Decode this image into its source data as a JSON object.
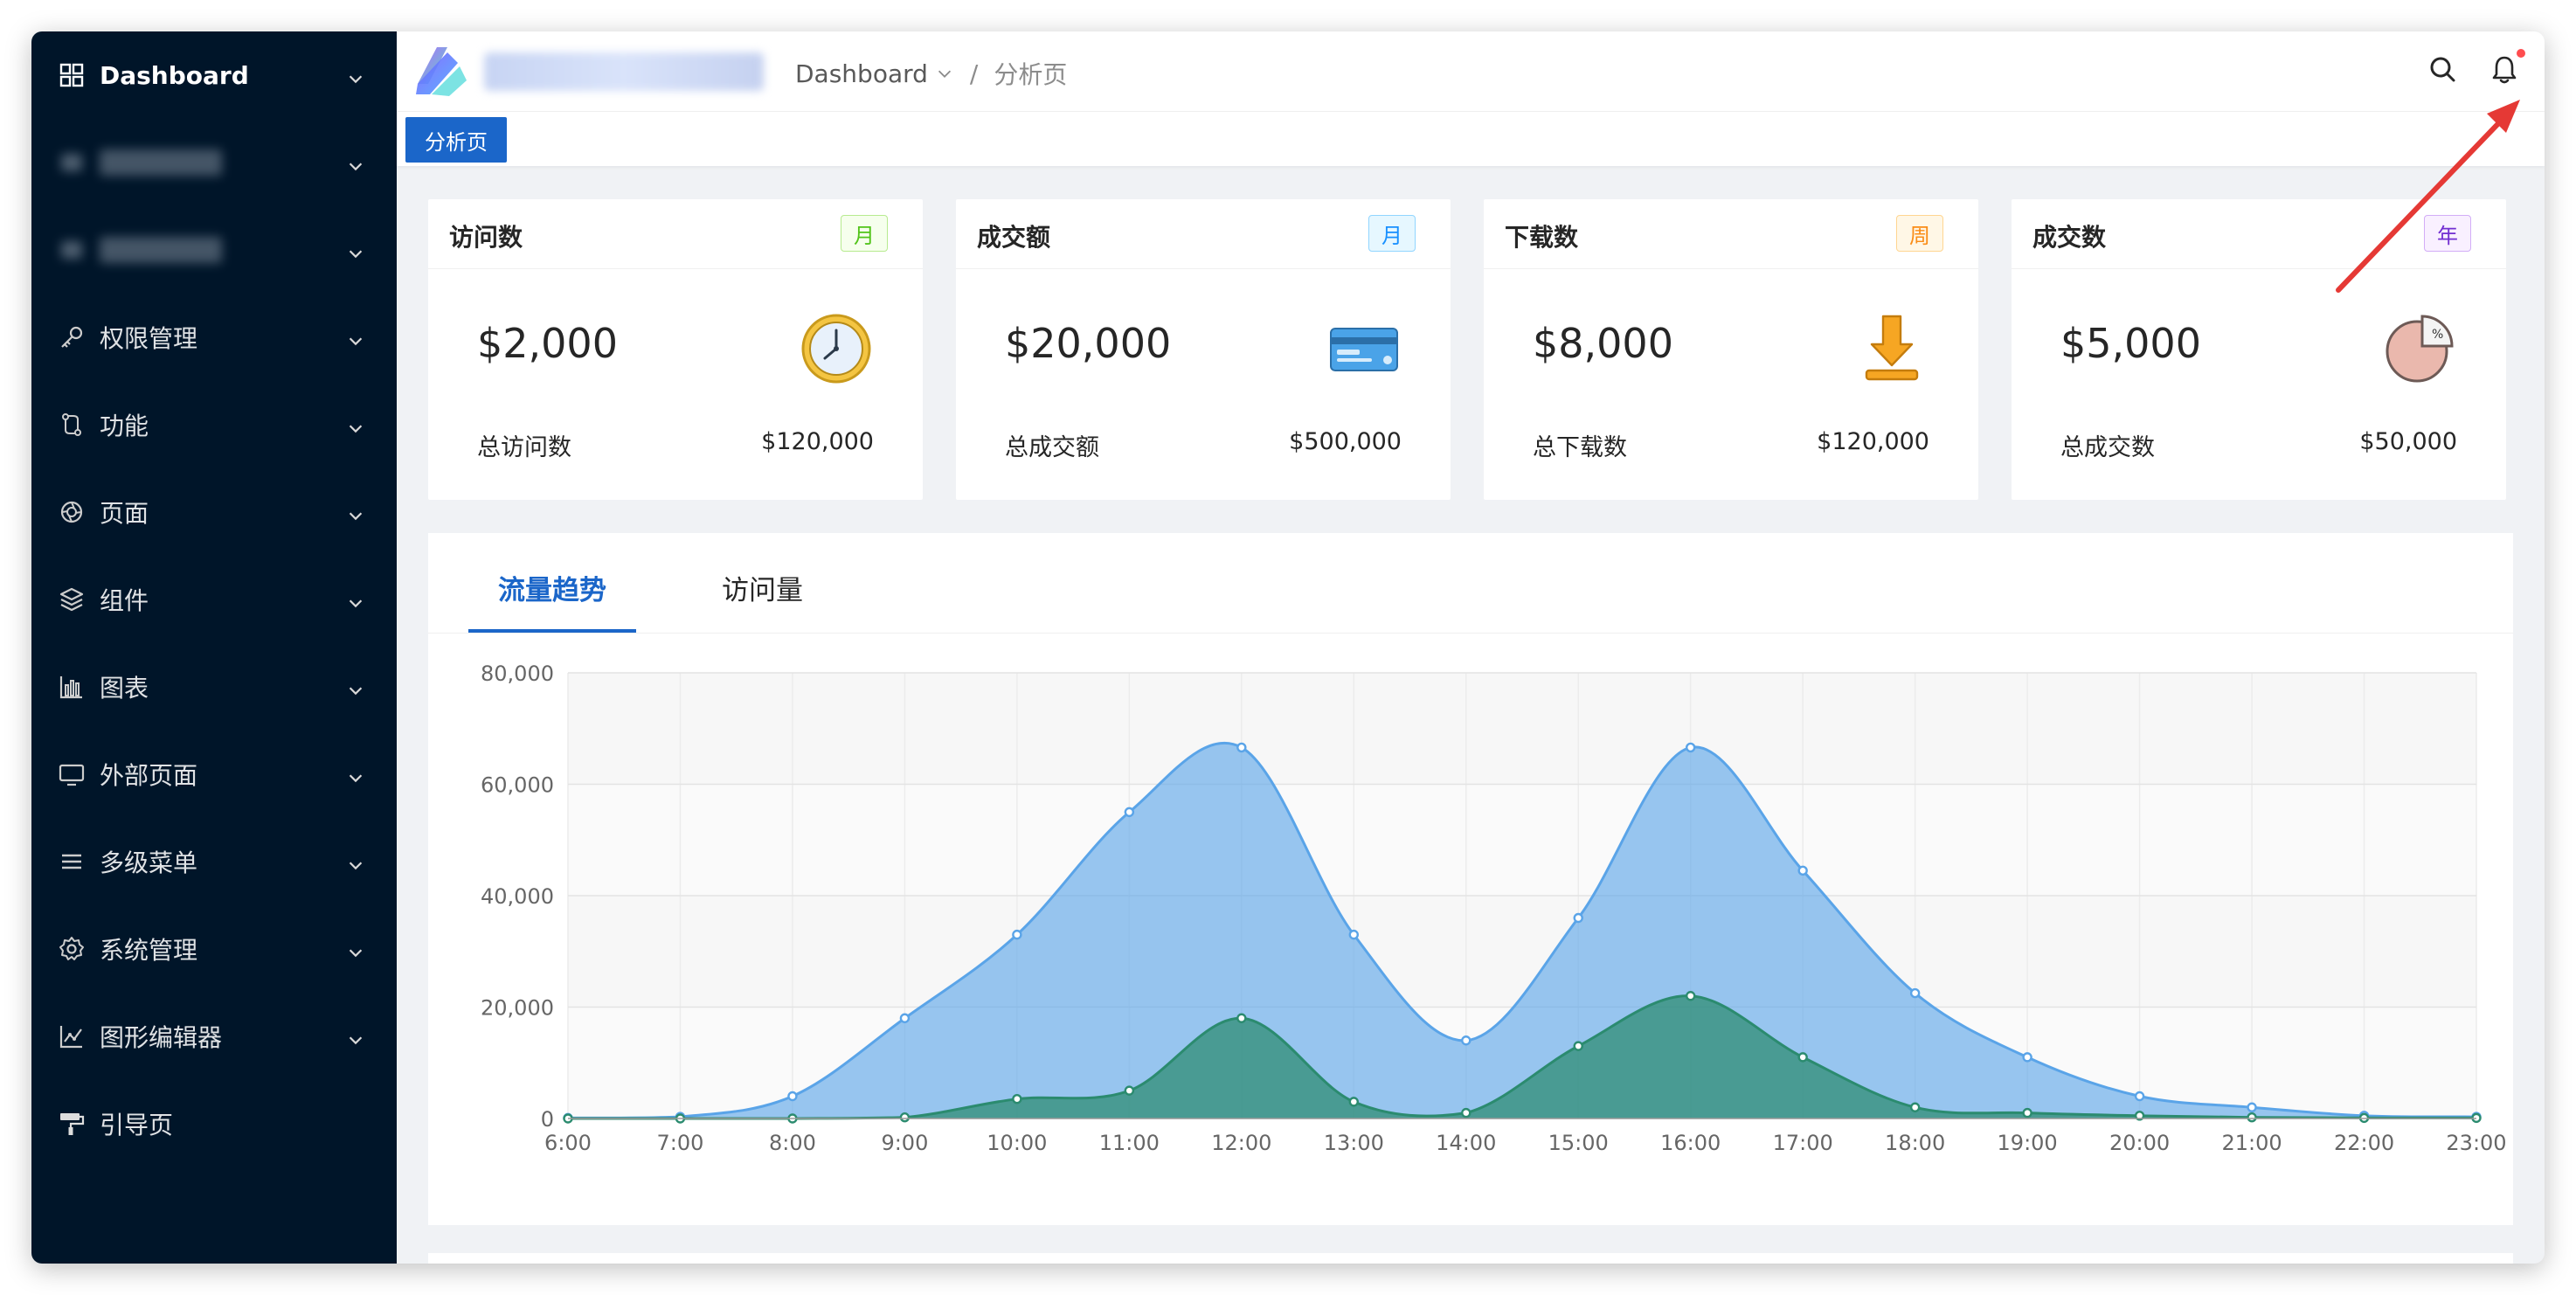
{
  "sidebar": {
    "items": [
      {
        "label": "Dashboard",
        "icon": "dashboard-icon",
        "active": true
      },
      {
        "label": "",
        "icon": "blurred-icon",
        "blurred": true
      },
      {
        "label": "",
        "icon": "blurred-icon",
        "blurred": true
      },
      {
        "label": "权限管理",
        "icon": "key-icon"
      },
      {
        "label": "功能",
        "icon": "swap-icon"
      },
      {
        "label": "页面",
        "icon": "aperture-icon"
      },
      {
        "label": "组件",
        "icon": "layers-icon"
      },
      {
        "label": "图表",
        "icon": "bar-chart-icon"
      },
      {
        "label": "外部页面",
        "icon": "monitor-icon"
      },
      {
        "label": "多级菜单",
        "icon": "menu-icon"
      },
      {
        "label": "系统管理",
        "icon": "gear-icon"
      },
      {
        "label": "图形编辑器",
        "icon": "line-chart-icon"
      },
      {
        "label": "引导页",
        "icon": "paint-roller-icon",
        "no_chevron": true
      }
    ]
  },
  "header": {
    "breadcrumb": {
      "parent": "Dashboard",
      "separator": "/",
      "current": "分析页"
    },
    "icons": [
      "search-icon",
      "bell-icon"
    ],
    "accent": "#1b66c9"
  },
  "tabbar": {
    "active_tab": "分析页"
  },
  "cards": [
    {
      "title": "访问数",
      "tag": "月",
      "tag_color": "#52c41a",
      "tag_bg": "#f6ffed",
      "tag_border": "#b7eb8f",
      "value": "$2,000",
      "foot_label": "总访问数",
      "foot_value": "$120,000",
      "icon": "clock-icon"
    },
    {
      "title": "成交额",
      "tag": "月",
      "tag_color": "#1890ff",
      "tag_bg": "#e6f7ff",
      "tag_border": "#91d5ff",
      "value": "$20,000",
      "foot_label": "总成交额",
      "foot_value": "$500,000",
      "icon": "credit-card-icon"
    },
    {
      "title": "下载数",
      "tag": "周",
      "tag_color": "#fa8c16",
      "tag_bg": "#fff7e6",
      "tag_border": "#ffd591",
      "value": "$8,000",
      "foot_label": "总下载数",
      "foot_value": "$120,000",
      "icon": "download-icon"
    },
    {
      "title": "成交数",
      "tag": "年",
      "tag_color": "#722ed1",
      "tag_bg": "#f9f0ff",
      "tag_border": "#d3adf7",
      "value": "$5,000",
      "foot_label": "总成交数",
      "foot_value": "$50,000",
      "icon": "pie-chart-icon"
    }
  ],
  "chart_tabs": [
    {
      "label": "流量趋势",
      "active": true
    },
    {
      "label": "访问量",
      "active": false
    }
  ],
  "chart_data": {
    "type": "area",
    "categories": [
      "6:00",
      "7:00",
      "8:00",
      "9:00",
      "10:00",
      "11:00",
      "12:00",
      "13:00",
      "14:00",
      "15:00",
      "16:00",
      "17:00",
      "18:00",
      "19:00",
      "20:00",
      "21:00",
      "22:00",
      "23:00"
    ],
    "ylim": [
      0,
      80000
    ],
    "yticks": [
      "0",
      "20,000",
      "40,000",
      "60,000",
      "80,000"
    ],
    "grid": true,
    "series": [
      {
        "values": [
          100,
          300,
          4000,
          18000,
          33000,
          55000,
          66600,
          33000,
          14000,
          36000,
          66600,
          44500,
          22500,
          11000,
          4000,
          2000,
          500,
          300
        ],
        "color": "#5aa4e8"
      },
      {
        "values": [
          0,
          0,
          0,
          200,
          3500,
          5000,
          18000,
          3000,
          1000,
          13000,
          22000,
          11000,
          2000,
          1000,
          500,
          200,
          100,
          100
        ],
        "color": "#2b8b6f"
      }
    ]
  }
}
